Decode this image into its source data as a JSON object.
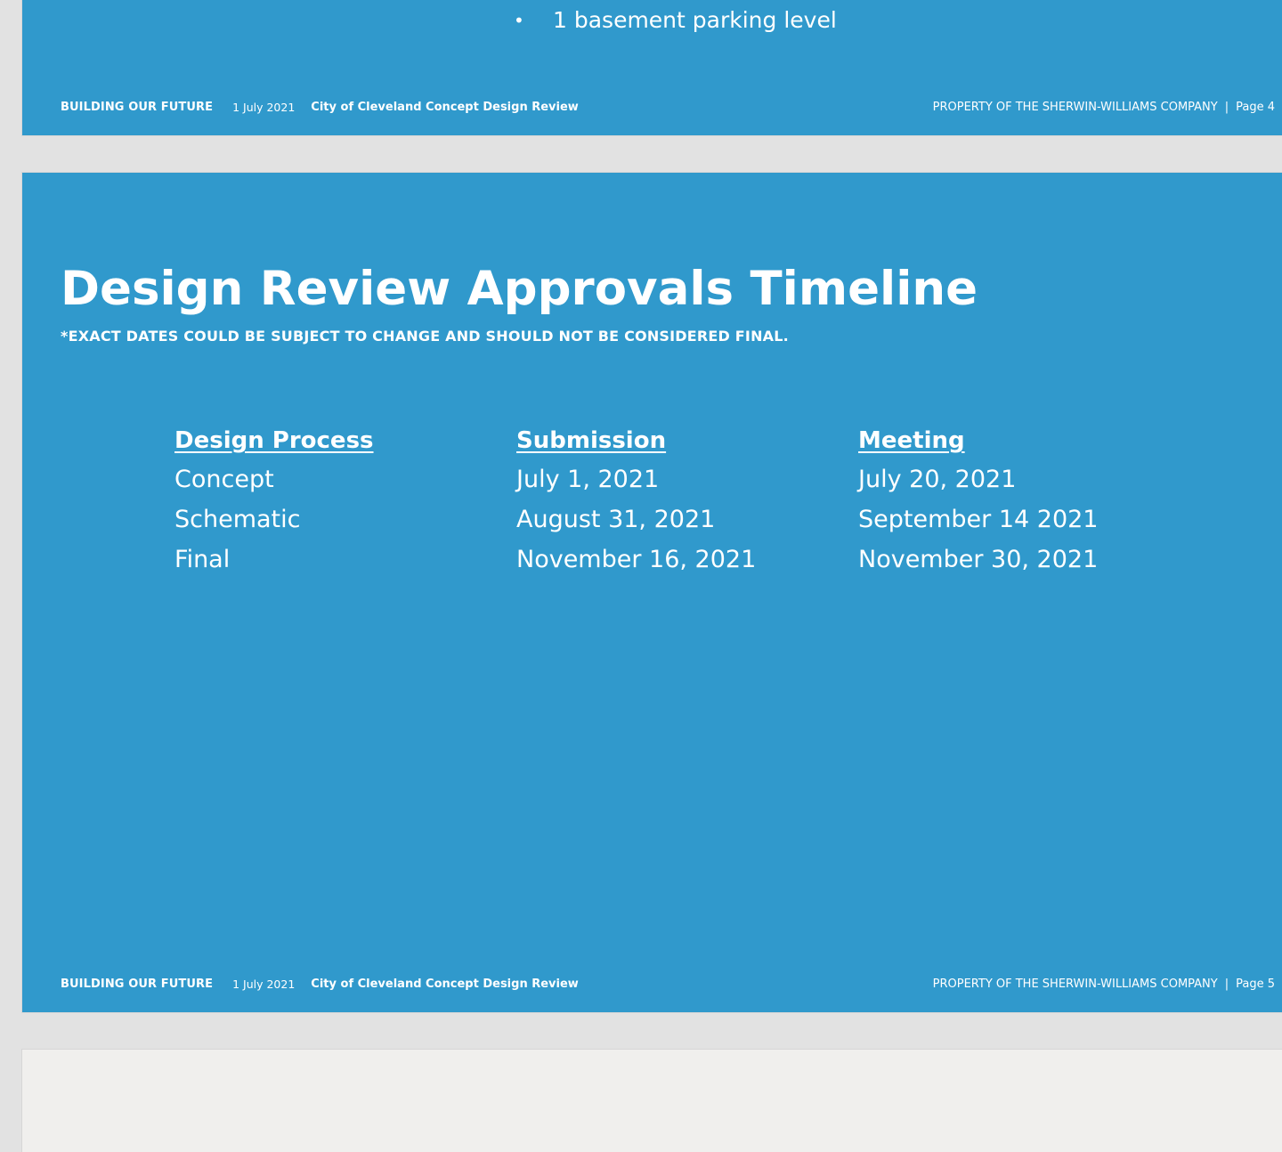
{
  "previous_slide": {
    "bullet_marker": "•",
    "bullet_text": "1 basement parking level",
    "footer": {
      "brand": "BUILDING OUR FUTURE",
      "date": "1 July 2021",
      "review": "City of Cleveland Concept Design Review",
      "property": "PROPERTY  OF THE SHERWIN-WILLIAMS COMPANY",
      "separator": "|",
      "page": "Page 4"
    }
  },
  "current_slide": {
    "title": "Design Review Approvals Timeline",
    "subtitle": "*EXACT DATES COULD BE SUBJECT TO CHANGE AND SHOULD NOT BE CONSIDERED FINAL.",
    "columns": [
      {
        "header": "Design Process",
        "cells": [
          "Concept",
          "Schematic",
          "Final"
        ]
      },
      {
        "header": "Submission",
        "cells": [
          "July 1, 2021",
          "August 31, 2021",
          "November 16, 2021"
        ]
      },
      {
        "header": "Meeting",
        "cells": [
          "July 20, 2021",
          "September 14 2021",
          "November 30, 2021"
        ]
      }
    ],
    "footer": {
      "brand": "BUILDING OUR FUTURE",
      "date": "1 July 2021",
      "review": "City of Cleveland Concept Design Review",
      "property": "PROPERTY  OF THE SHERWIN-WILLIAMS COMPANY",
      "separator": "|",
      "page": "Page 5"
    }
  },
  "colors": {
    "slide_background": "#3099cc",
    "page_background": "#e2e2e2",
    "next_slide_background": "#f0efed",
    "text": "#ffffff"
  }
}
